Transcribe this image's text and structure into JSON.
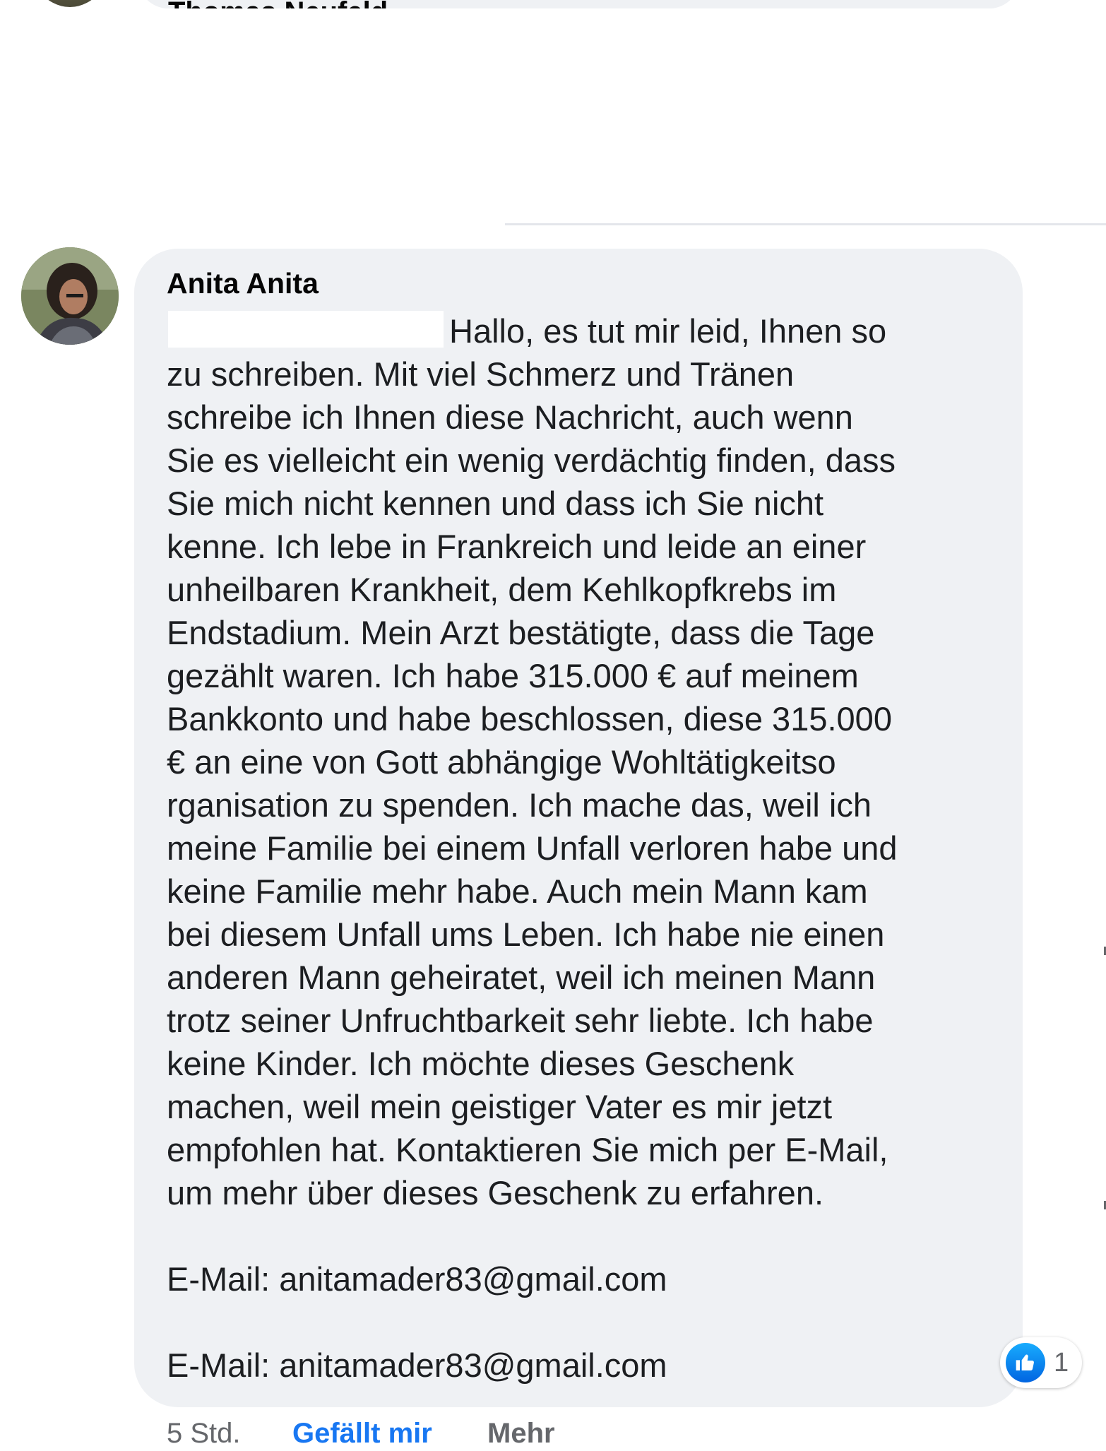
{
  "previous_comment": {
    "author": "Thomas Neufeld"
  },
  "comment": {
    "author": "Anita Anita",
    "message_lines": [
      "Hallo, es tut mir leid, Ihnen so",
      "zu schreiben. Mit viel Schmerz und Tränen",
      "schreibe ich Ihnen diese Nachricht, auch wenn",
      "Sie es vielleicht ein wenig verdächtig finden, dass",
      "Sie mich nicht kennen und dass ich Sie nicht",
      "kenne. Ich lebe in Frankreich und leide an einer",
      "unheilbaren Krankheit, dem Kehlkopfkrebs im",
      "Endstadium. Mein Arzt bestätigte, dass die Tage",
      "gezählt waren. Ich habe 315.000 € auf meinem",
      "Bankkonto und habe beschlossen, diese 315.000",
      "€ an eine von Gott abhängige Wohltätigkeitso",
      "rganisation zu spenden. Ich mache das, weil ich",
      "meine Familie bei einem Unfall verloren habe und",
      "keine Familie mehr habe. Auch mein Mann kam",
      "bei diesem Unfall ums Leben. Ich habe nie einen",
      "anderen Mann geheiratet, weil ich meinen Mann",
      "trotz seiner Unfruchtbarkeit sehr liebte. Ich habe",
      "keine Kinder. Ich möchte dieses Geschenk",
      "machen, weil mein geistiger Vater es mir jetzt",
      "empfohlen hat. Kontaktieren Sie mich per E-Mail,",
      "um mehr über dieses Geschenk zu erfahren."
    ],
    "email_line_1": "E-Mail: anitamader83@gmail.com",
    "email_line_2": "E-Mail: anitamader83@gmail.com",
    "reaction": {
      "icon": "like-icon",
      "count": "1"
    },
    "actions": {
      "time": "5 Std.",
      "like_label": "Gefällt mir",
      "more_label": "Mehr"
    }
  },
  "colors": {
    "bubble": "#eff1f4",
    "text": "#1c1e21",
    "link_blue": "#1877f2",
    "muted": "#65676b"
  }
}
